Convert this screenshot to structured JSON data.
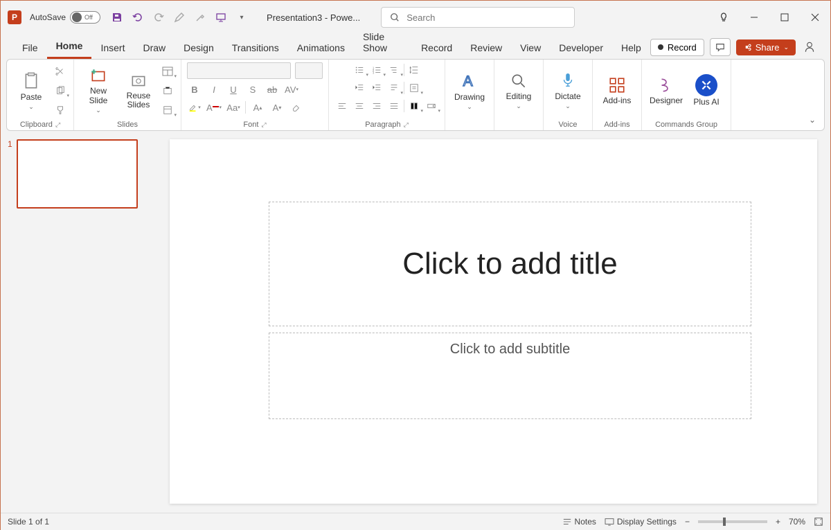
{
  "titlebar": {
    "autosave_label": "AutoSave",
    "autosave_state": "Off",
    "document_title": "Presentation3 - Powe...",
    "search_placeholder": "Search"
  },
  "tabs": {
    "file": "File",
    "home": "Home",
    "insert": "Insert",
    "draw": "Draw",
    "design": "Design",
    "transitions": "Transitions",
    "animations": "Animations",
    "slideshow": "Slide Show",
    "record": "Record",
    "review": "Review",
    "view": "View",
    "developer": "Developer",
    "help": "Help",
    "record_btn": "Record",
    "share_btn": "Share"
  },
  "ribbon": {
    "clipboard": {
      "paste": "Paste",
      "label": "Clipboard"
    },
    "slides": {
      "newslide": "New Slide",
      "reuse": "Reuse Slides",
      "label": "Slides"
    },
    "font": {
      "label": "Font"
    },
    "paragraph": {
      "label": "Paragraph"
    },
    "drawing": {
      "btn": "Drawing",
      "label": ""
    },
    "editing": {
      "btn": "Editing"
    },
    "voice": {
      "dictate": "Dictate",
      "label": "Voice"
    },
    "addins": {
      "btn": "Add-ins",
      "label": "Add-ins"
    },
    "designer": {
      "btn": "Designer"
    },
    "plusai": {
      "btn": "Plus AI"
    },
    "commands_label": "Commands Group"
  },
  "slides_panel": {
    "slide1_num": "1"
  },
  "canvas": {
    "title_placeholder": "Click to add title",
    "subtitle_placeholder": "Click to add subtitle"
  },
  "statusbar": {
    "slide_info": "Slide 1 of 1",
    "notes": "Notes",
    "display": "Display Settings",
    "zoom": "70%"
  }
}
